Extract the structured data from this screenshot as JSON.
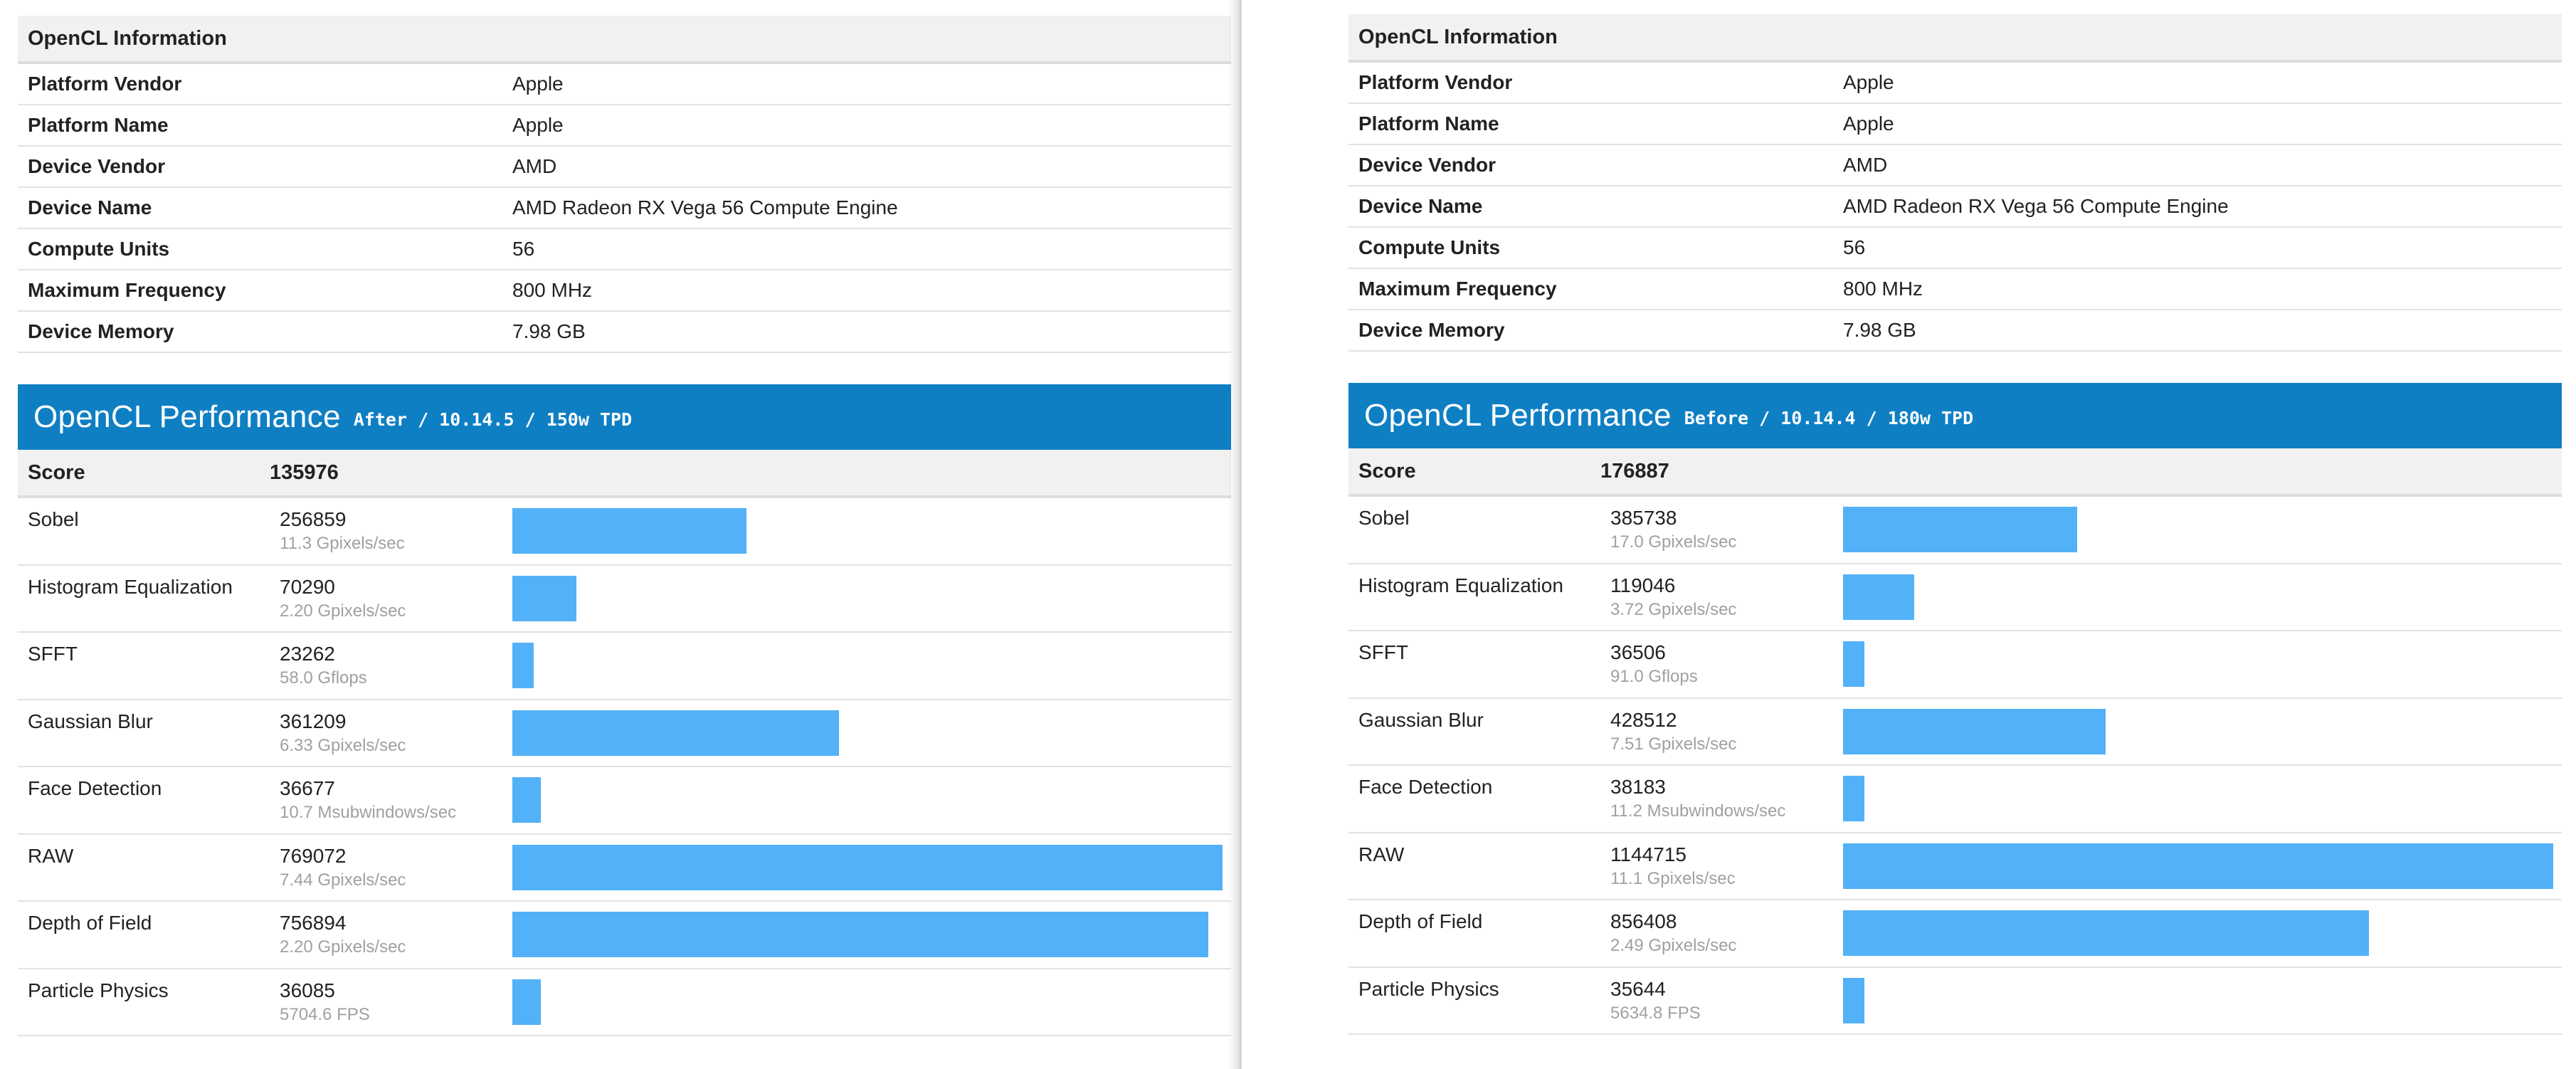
{
  "left": {
    "info": {
      "header": "OpenCL Information",
      "rows": [
        {
          "key": "Platform Vendor",
          "value": "Apple"
        },
        {
          "key": "Platform Name",
          "value": "Apple"
        },
        {
          "key": "Device Vendor",
          "value": "AMD"
        },
        {
          "key": "Device Name",
          "value": "AMD Radeon RX Vega 56 Compute Engine"
        },
        {
          "key": "Compute Units",
          "value": "56"
        },
        {
          "key": "Maximum Frequency",
          "value": "800 MHz"
        },
        {
          "key": "Device Memory",
          "value": "7.98 GB"
        }
      ]
    },
    "perf": {
      "title": "OpenCL Performance",
      "note": "After / 10.14.5 / 150w TPD",
      "score_label": "Score",
      "score_value": "135976",
      "tests": [
        {
          "name": "Sobel",
          "score": "256859",
          "rate": "11.3 Gpixels/sec",
          "level": 0.33
        },
        {
          "name": "Histogram Equalization",
          "score": "70290",
          "rate": "2.20 Gpixels/sec",
          "level": 0.09
        },
        {
          "name": "SFFT",
          "score": "23262",
          "rate": "58.0 Gflops",
          "level": 0.03
        },
        {
          "name": "Gaussian Blur",
          "score": "361209",
          "rate": "6.33 Gpixels/sec",
          "level": 0.46
        },
        {
          "name": "Face Detection",
          "score": "36677",
          "rate": "10.7 Msubwindows/sec",
          "level": 0.04
        },
        {
          "name": "RAW",
          "score": "769072",
          "rate": "7.44 Gpixels/sec",
          "level": 1.0
        },
        {
          "name": "Depth of Field",
          "score": "756894",
          "rate": "2.20 Gpixels/sec",
          "level": 0.98
        },
        {
          "name": "Particle Physics",
          "score": "36085",
          "rate": "5704.6 FPS",
          "level": 0.04
        }
      ]
    }
  },
  "right": {
    "info": {
      "header": "OpenCL Information",
      "rows": [
        {
          "key": "Platform Vendor",
          "value": "Apple"
        },
        {
          "key": "Platform Name",
          "value": "Apple"
        },
        {
          "key": "Device Vendor",
          "value": "AMD"
        },
        {
          "key": "Device Name",
          "value": "AMD Radeon RX Vega 56 Compute Engine"
        },
        {
          "key": "Compute Units",
          "value": "56"
        },
        {
          "key": "Maximum Frequency",
          "value": "800 MHz"
        },
        {
          "key": "Device Memory",
          "value": "7.98 GB"
        }
      ]
    },
    "perf": {
      "title": "OpenCL Performance",
      "note": "Before / 10.14.4 / 180w TPD",
      "score_label": "Score",
      "score_value": "176887",
      "tests": [
        {
          "name": "Sobel",
          "score": "385738",
          "rate": "17.0 Gpixels/sec",
          "level": 0.33
        },
        {
          "name": "Histogram Equalization",
          "score": "119046",
          "rate": "3.72 Gpixels/sec",
          "level": 0.1
        },
        {
          "name": "SFFT",
          "score": "36506",
          "rate": "91.0 Gflops",
          "level": 0.03
        },
        {
          "name": "Gaussian Blur",
          "score": "428512",
          "rate": "7.51 Gpixels/sec",
          "level": 0.37
        },
        {
          "name": "Face Detection",
          "score": "38183",
          "rate": "11.2 Msubwindows/sec",
          "level": 0.03
        },
        {
          "name": "RAW",
          "score": "1144715",
          "rate": "11.1 Gpixels/sec",
          "level": 1.0
        },
        {
          "name": "Depth of Field",
          "score": "856408",
          "rate": "2.49 Gpixels/sec",
          "level": 0.74
        },
        {
          "name": "Particle Physics",
          "score": "35644",
          "rate": "5634.8 FPS",
          "level": 0.03
        }
      ]
    }
  },
  "colors": {
    "bar": "#52b1f7",
    "perf_header": "#0f7fc4",
    "info_header_bg": "#f1f1f1",
    "muted_text": "#a0a0a0"
  }
}
